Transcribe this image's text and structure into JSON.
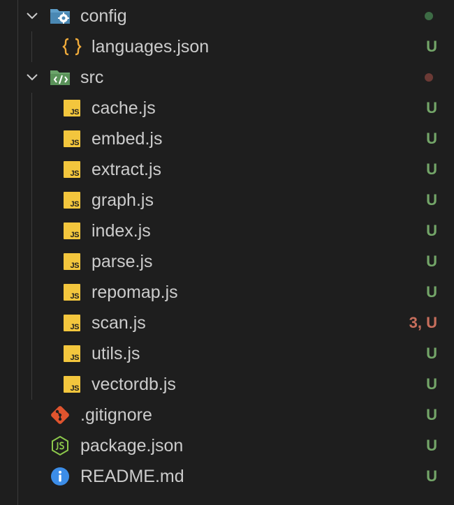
{
  "colors": {
    "untracked": "#73a568",
    "error": "#c76e5c",
    "dot_green": "#3d6b45",
    "dot_red": "#6b3a35",
    "js_yellow": "#f3c63d",
    "folder_blue": "#5e9ec9",
    "src_green": "#6ba46a",
    "git_orange": "#e0542e",
    "node_green": "#8cc84b",
    "info_blue": "#3c8de8"
  },
  "tree": {
    "config": {
      "label": "config",
      "icon": "config-folder-icon",
      "expanded": true,
      "status": "dot"
    },
    "languages": {
      "label": "languages.json",
      "icon": "json-braces-icon",
      "badge": "U"
    },
    "src": {
      "label": "src",
      "icon": "src-folder-icon",
      "expanded": true,
      "status": "dot"
    },
    "files": [
      {
        "label": "cache.js",
        "badge": "U"
      },
      {
        "label": "embed.js",
        "badge": "U"
      },
      {
        "label": "extract.js",
        "badge": "U"
      },
      {
        "label": "graph.js",
        "badge": "U"
      },
      {
        "label": "index.js",
        "badge": "U"
      },
      {
        "label": "parse.js",
        "badge": "U"
      },
      {
        "label": "repomap.js",
        "badge": "U"
      },
      {
        "label": "scan.js",
        "badge": "3, U"
      },
      {
        "label": "utils.js",
        "badge": "U"
      },
      {
        "label": "vectordb.js",
        "badge": "U"
      }
    ],
    "js_icon_text": "JS",
    "gitignore": {
      "label": ".gitignore",
      "icon": "git-icon",
      "badge": "U"
    },
    "package": {
      "label": "package.json",
      "icon": "nodejs-icon",
      "badge": "U"
    },
    "readme": {
      "label": "README.md",
      "icon": "info-icon",
      "badge": "U"
    }
  }
}
